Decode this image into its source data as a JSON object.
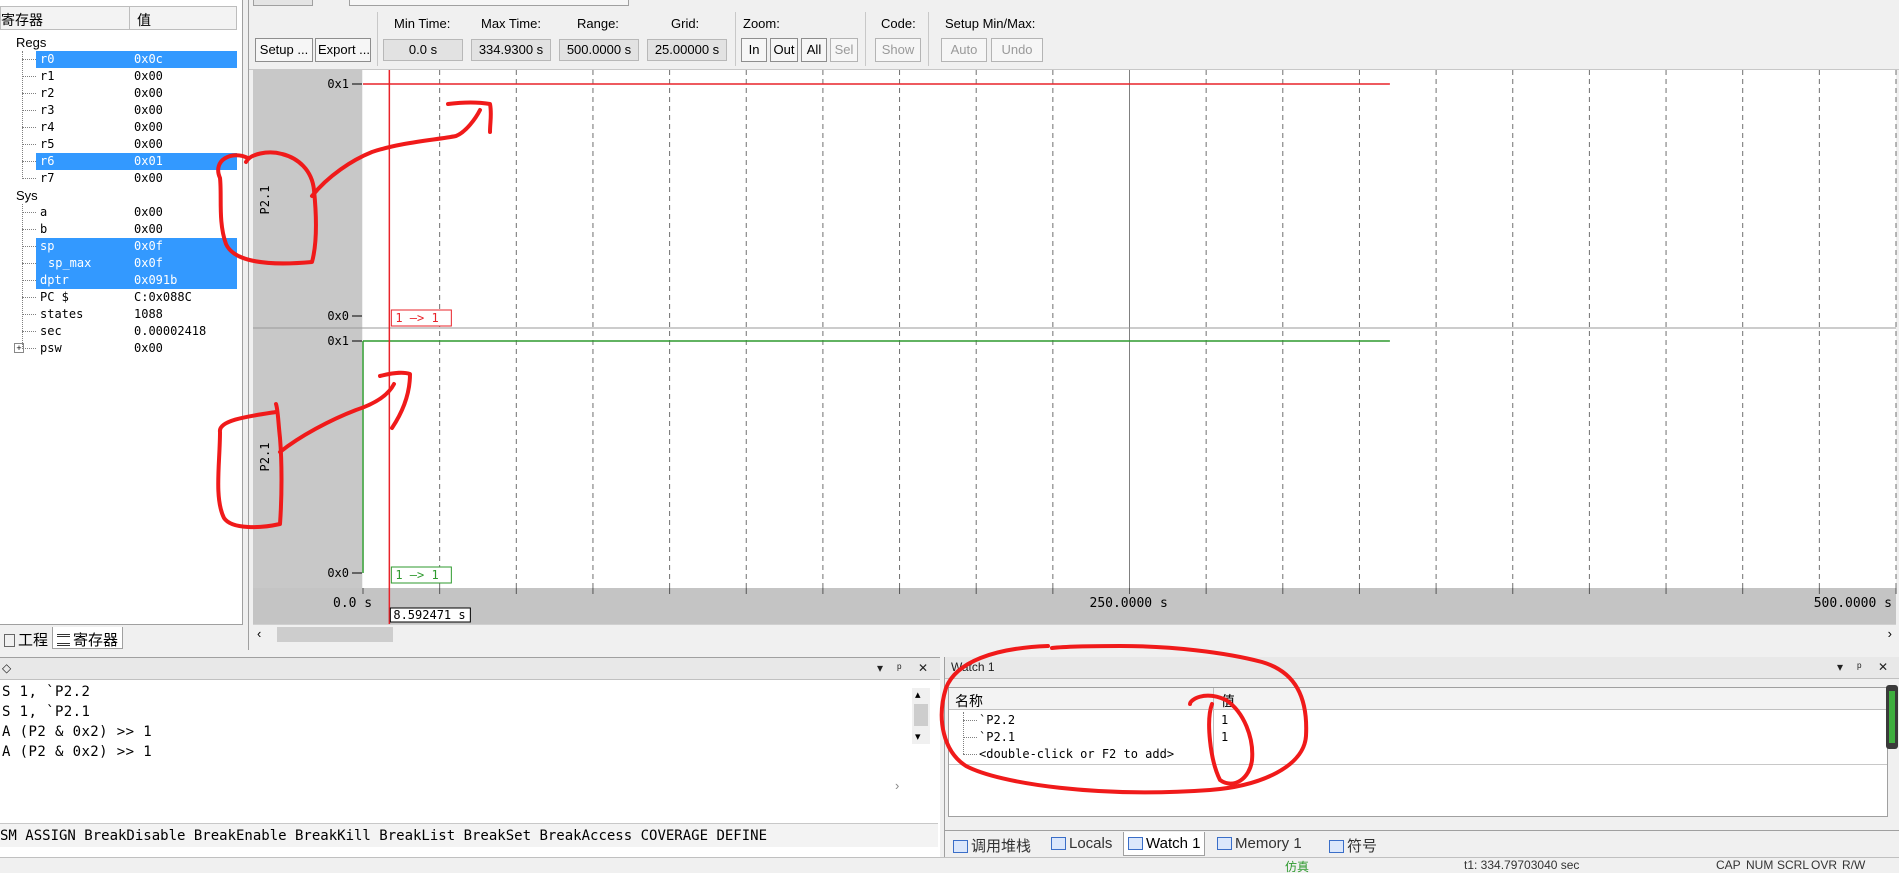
{
  "registers": {
    "header_name": "寄存器",
    "header_value": "值",
    "groups": [
      {
        "label": "Regs",
        "items": [
          {
            "name": "r0",
            "value": "0x0c",
            "selected": true
          },
          {
            "name": "r1",
            "value": "0x00",
            "selected": false
          },
          {
            "name": "r2",
            "value": "0x00",
            "selected": false
          },
          {
            "name": "r3",
            "value": "0x00",
            "selected": false
          },
          {
            "name": "r4",
            "value": "0x00",
            "selected": false
          },
          {
            "name": "r5",
            "value": "0x00",
            "selected": false
          },
          {
            "name": "r6",
            "value": "0x01",
            "selected": true
          },
          {
            "name": "r7",
            "value": "0x00",
            "selected": false
          }
        ]
      },
      {
        "label": "Sys",
        "items": [
          {
            "name": "a",
            "value": "0x00",
            "selected": false
          },
          {
            "name": "b",
            "value": "0x00",
            "selected": false
          },
          {
            "name": "sp",
            "value": "0x0f",
            "selected": true
          },
          {
            "name": "sp_max",
            "value": "0x0f",
            "selected": true
          },
          {
            "name": "dptr",
            "value": "0x091b",
            "selected": true
          },
          {
            "name": "PC  $",
            "value": "C:0x088C",
            "selected": false
          },
          {
            "name": "states",
            "value": "1088",
            "selected": false
          },
          {
            "name": "sec",
            "value": "0.00002418",
            "selected": false
          },
          {
            "name": "psw",
            "value": "0x00",
            "selected": false
          }
        ]
      }
    ],
    "tabs": [
      {
        "label": "工程",
        "active": false
      },
      {
        "label": "寄存器",
        "active": true
      }
    ]
  },
  "analyzer": {
    "toolbar": {
      "setup_btn": "Setup ...",
      "export_btn": "Export ...",
      "min_time_label": "Min Time:",
      "min_time": "0.0 s",
      "max_time_label": "Max Time:",
      "max_time": "334.9300 s",
      "range_label": "Range:",
      "range": "500.0000 s",
      "grid_label": "Grid:",
      "grid": "25.00000 s",
      "zoom_label": "Zoom:",
      "zoom_in": "In",
      "zoom_out": "Out",
      "zoom_all": "All",
      "zoom_sel": "Sel",
      "code_label": "Code:",
      "code_show": "Show",
      "minmax_label": "Setup Min/Max:",
      "auto_btn": "Auto",
      "undo_btn": "Undo"
    },
    "signals": [
      {
        "name": "P2.1",
        "high_label": "0x1",
        "low_label": "0x0",
        "color": "#e8232a",
        "value_tag": "1 —> 1"
      },
      {
        "name": "P2.1",
        "high_label": "0x1",
        "low_label": "0x0",
        "color": "#2e9a2e",
        "value_tag": "1 —> 1"
      }
    ],
    "time_axis": {
      "start_label": "0.0 s",
      "mid_label": "250.0000 s",
      "end_label": "500.0000 s",
      "cursor_label": "8.592471 s"
    },
    "chart_data": {
      "type": "line",
      "x_range_s": [
        0,
        500
      ],
      "grid_s": 25,
      "cursor_s": 8.592471,
      "data_end_s": 334.93,
      "series": [
        {
          "name": "P2.1",
          "x": [
            0,
            334.93
          ],
          "y": [
            1,
            1
          ]
        },
        {
          "name": "P2.1",
          "x": [
            0,
            334.93
          ],
          "y": [
            1,
            1
          ]
        }
      ]
    }
  },
  "command": {
    "lines": [
      "S 1, `P2.2",
      "S 1, `P2.1",
      "A (P2 & 0x2) >> 1",
      "A (P2 & 0x2) >> 1"
    ],
    "hint": "SM ASSIGN BreakDisable BreakEnable BreakKill BreakList BreakSet BreakAccess COVERAGE DEFINE",
    "title_controls": [
      "▾",
      "ᵖ",
      "✕"
    ]
  },
  "watch": {
    "title": "Watch 1",
    "col_name": "名称",
    "col_value": "值",
    "rows": [
      {
        "name": "`P2.2",
        "value": "1"
      },
      {
        "name": "`P2.1",
        "value": "1"
      },
      {
        "name": "<double-click or F2 to add>",
        "value": ""
      }
    ],
    "tabs": [
      {
        "label": "调用堆栈",
        "active": false
      },
      {
        "label": "Locals",
        "active": false
      },
      {
        "label": "Watch 1",
        "active": true
      },
      {
        "label": "Memory 1",
        "active": false
      },
      {
        "label": "符号",
        "active": false
      }
    ]
  },
  "status": {
    "left": "仿真",
    "time": "t1: 334.79703040 sec",
    "flags": [
      "CAP",
      "NUM",
      "SCRL",
      "OVR",
      "R/W"
    ]
  }
}
